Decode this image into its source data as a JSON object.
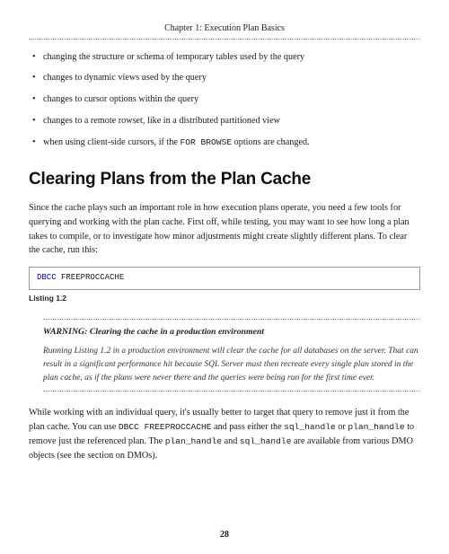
{
  "chapter_header": "Chapter 1: Execution Plan Basics",
  "bullets": [
    "changing the structure or schema of temporary tables used by the query",
    "changes to dynamic views used by the query",
    "changes to cursor options within the query",
    "changes to a remote rowset, like in a distributed partitioned view",
    {
      "prefix": "when using client-side cursors, if the ",
      "code": "FOR BROWSE",
      "suffix": " options are changed."
    }
  ],
  "section_heading": "Clearing Plans from the Plan Cache",
  "intro_para": "Since the cache plays such an important role in how execution plans operate, you need a few tools for querying and working with the plan cache. First off, while testing, you may want to see how long a plan takes to compile, or to investigate how minor adjustments might create slightly different plans. To clear the cache, run this:",
  "code_listing": {
    "keyword": "DBCC",
    "rest": " FREEPROCCACHE"
  },
  "listing_label": "Listing 1.2",
  "warning": {
    "title": "WARNING: Clearing the cache in a production environment",
    "body": "Running Listing 1.2 in a production environment will clear the cache for all databases on the server. That can result in a significant performance hit because SQL Server must then recreate every single plan stored in the plan cache, as if the plans were never there and the queries were being run for the first time ever."
  },
  "closing_para": {
    "p1": "While working with an individual query, it's usually better to target that query to remove just it from the plan cache. You can use ",
    "c1": "DBCC FREEPROCCACHE",
    "p2": " and pass either the ",
    "c2": "sql_handle",
    "p3": " or ",
    "c3": "plan_handle",
    "p4": " to remove just the referenced plan. The ",
    "c4": "plan_handle",
    "p5": " and ",
    "c5": "sql_handle",
    "p6": " are available from various DMO objects (see the section on DMOs)."
  },
  "page_number": "28"
}
